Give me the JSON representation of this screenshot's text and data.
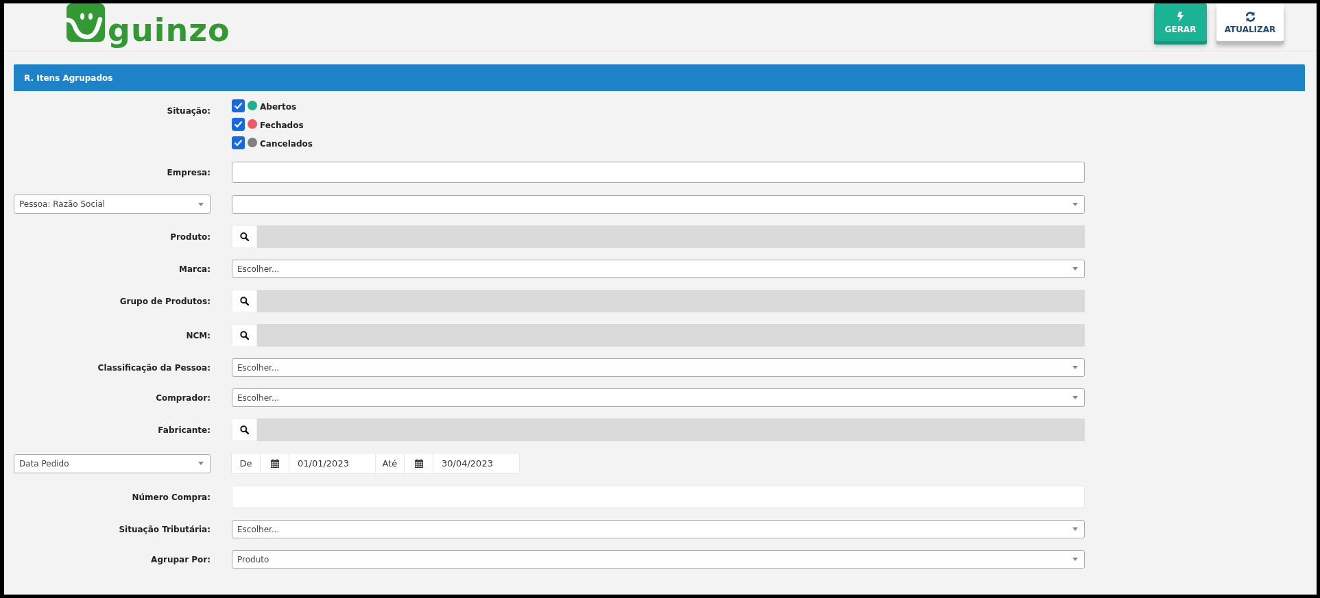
{
  "logo": {
    "text": "guinzo"
  },
  "toolbar": [
    {
      "label": "GERAR",
      "kind": "primary"
    },
    {
      "label": "ATUALIZAR",
      "kind": "secondary"
    }
  ],
  "panel": {
    "title": "R. Itens Agrupados"
  },
  "fields": [
    {
      "label": "Situação:",
      "kind": "checkboxes",
      "options": [
        {
          "label": "Abertos",
          "checked": true,
          "color": "#1cb08f"
        },
        {
          "label": "Fechados",
          "checked": true,
          "color": "#ee5a67"
        },
        {
          "label": "Cancelados",
          "checked": true,
          "color": "#808080"
        }
      ]
    },
    {
      "label": "Empresa:",
      "kind": "text"
    },
    {
      "label_select": "Pessoa: Razão Social",
      "kind": "select"
    },
    {
      "label": "Produto:",
      "kind": "lookup"
    },
    {
      "label": "Marca:",
      "kind": "select",
      "value": "Escolher..."
    },
    {
      "label": "Grupo de Produtos:",
      "kind": "lookup"
    },
    {
      "label": "NCM:",
      "kind": "lookup"
    },
    {
      "label": "Classificação da Pessoa:",
      "kind": "select",
      "value": "Escolher..."
    },
    {
      "label": "Comprador:",
      "kind": "select",
      "value": "Escolher..."
    },
    {
      "label": "Fabricante:",
      "kind": "lookup"
    },
    {
      "label_select": "Data Pedido",
      "kind": "daterange",
      "from_label": "De",
      "from": "01/01/2023",
      "to_label": "Até",
      "to": "30/04/2023"
    },
    {
      "label": "Número Compra:",
      "kind": "plain"
    },
    {
      "label": "Situação Tributária:",
      "kind": "select",
      "value": "Escolher..."
    },
    {
      "label": "Agrupar Por:",
      "kind": "select",
      "value": "Produto"
    }
  ]
}
